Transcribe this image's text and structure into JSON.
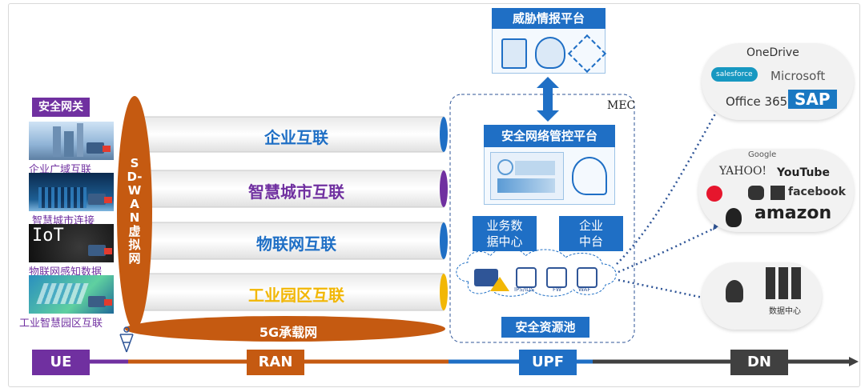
{
  "gateway": {
    "title": "安全网关",
    "items": [
      "企业广域互联",
      "智慧城市连接",
      "物联网感知数据",
      "工业智慧园区互联"
    ],
    "iot_text": "IoT"
  },
  "sdwan": {
    "label": "SD-WAN虚拟网"
  },
  "pipes": [
    {
      "label": "企业互联",
      "color": "#1f6fc5"
    },
    {
      "label": "智慧城市互联",
      "color": "#7030a0"
    },
    {
      "label": "物联网互联",
      "color": "#1f6fc5"
    },
    {
      "label": "工业园区互联",
      "color": "#f2b705"
    }
  ],
  "bearer": {
    "label": "5G承载网"
  },
  "threat_platform": {
    "title": "威胁情报平台"
  },
  "mec": {
    "label": "MEC",
    "mgmt_title": "安全网络管控平台",
    "biz_box_line1": "业务数",
    "biz_box_line2": "据中心",
    "ent_box_line1": "企业",
    "ent_box_line2": "中台",
    "pool_label": "安全资源池",
    "pool_icon_labels": [
      "IPS/IDS",
      "FW",
      "WAF"
    ]
  },
  "clouds": {
    "top": [
      "OneDrive",
      "salesforce",
      "Microsoft",
      "Office 365",
      "SAP"
    ],
    "middle": [
      "Google",
      "YAHOO!",
      "YouTube",
      "facebook",
      "amazon"
    ],
    "bottom": [
      "数据中心"
    ]
  },
  "bottom_bar": {
    "ue": "UE",
    "ran": "RAN",
    "upf": "UPF",
    "dn": "DN"
  },
  "colors": {
    "purple": "#7030a0",
    "orange": "#c55a11",
    "blue": "#1f6fc5",
    "dark": "#404040",
    "yellow": "#f2b705"
  }
}
